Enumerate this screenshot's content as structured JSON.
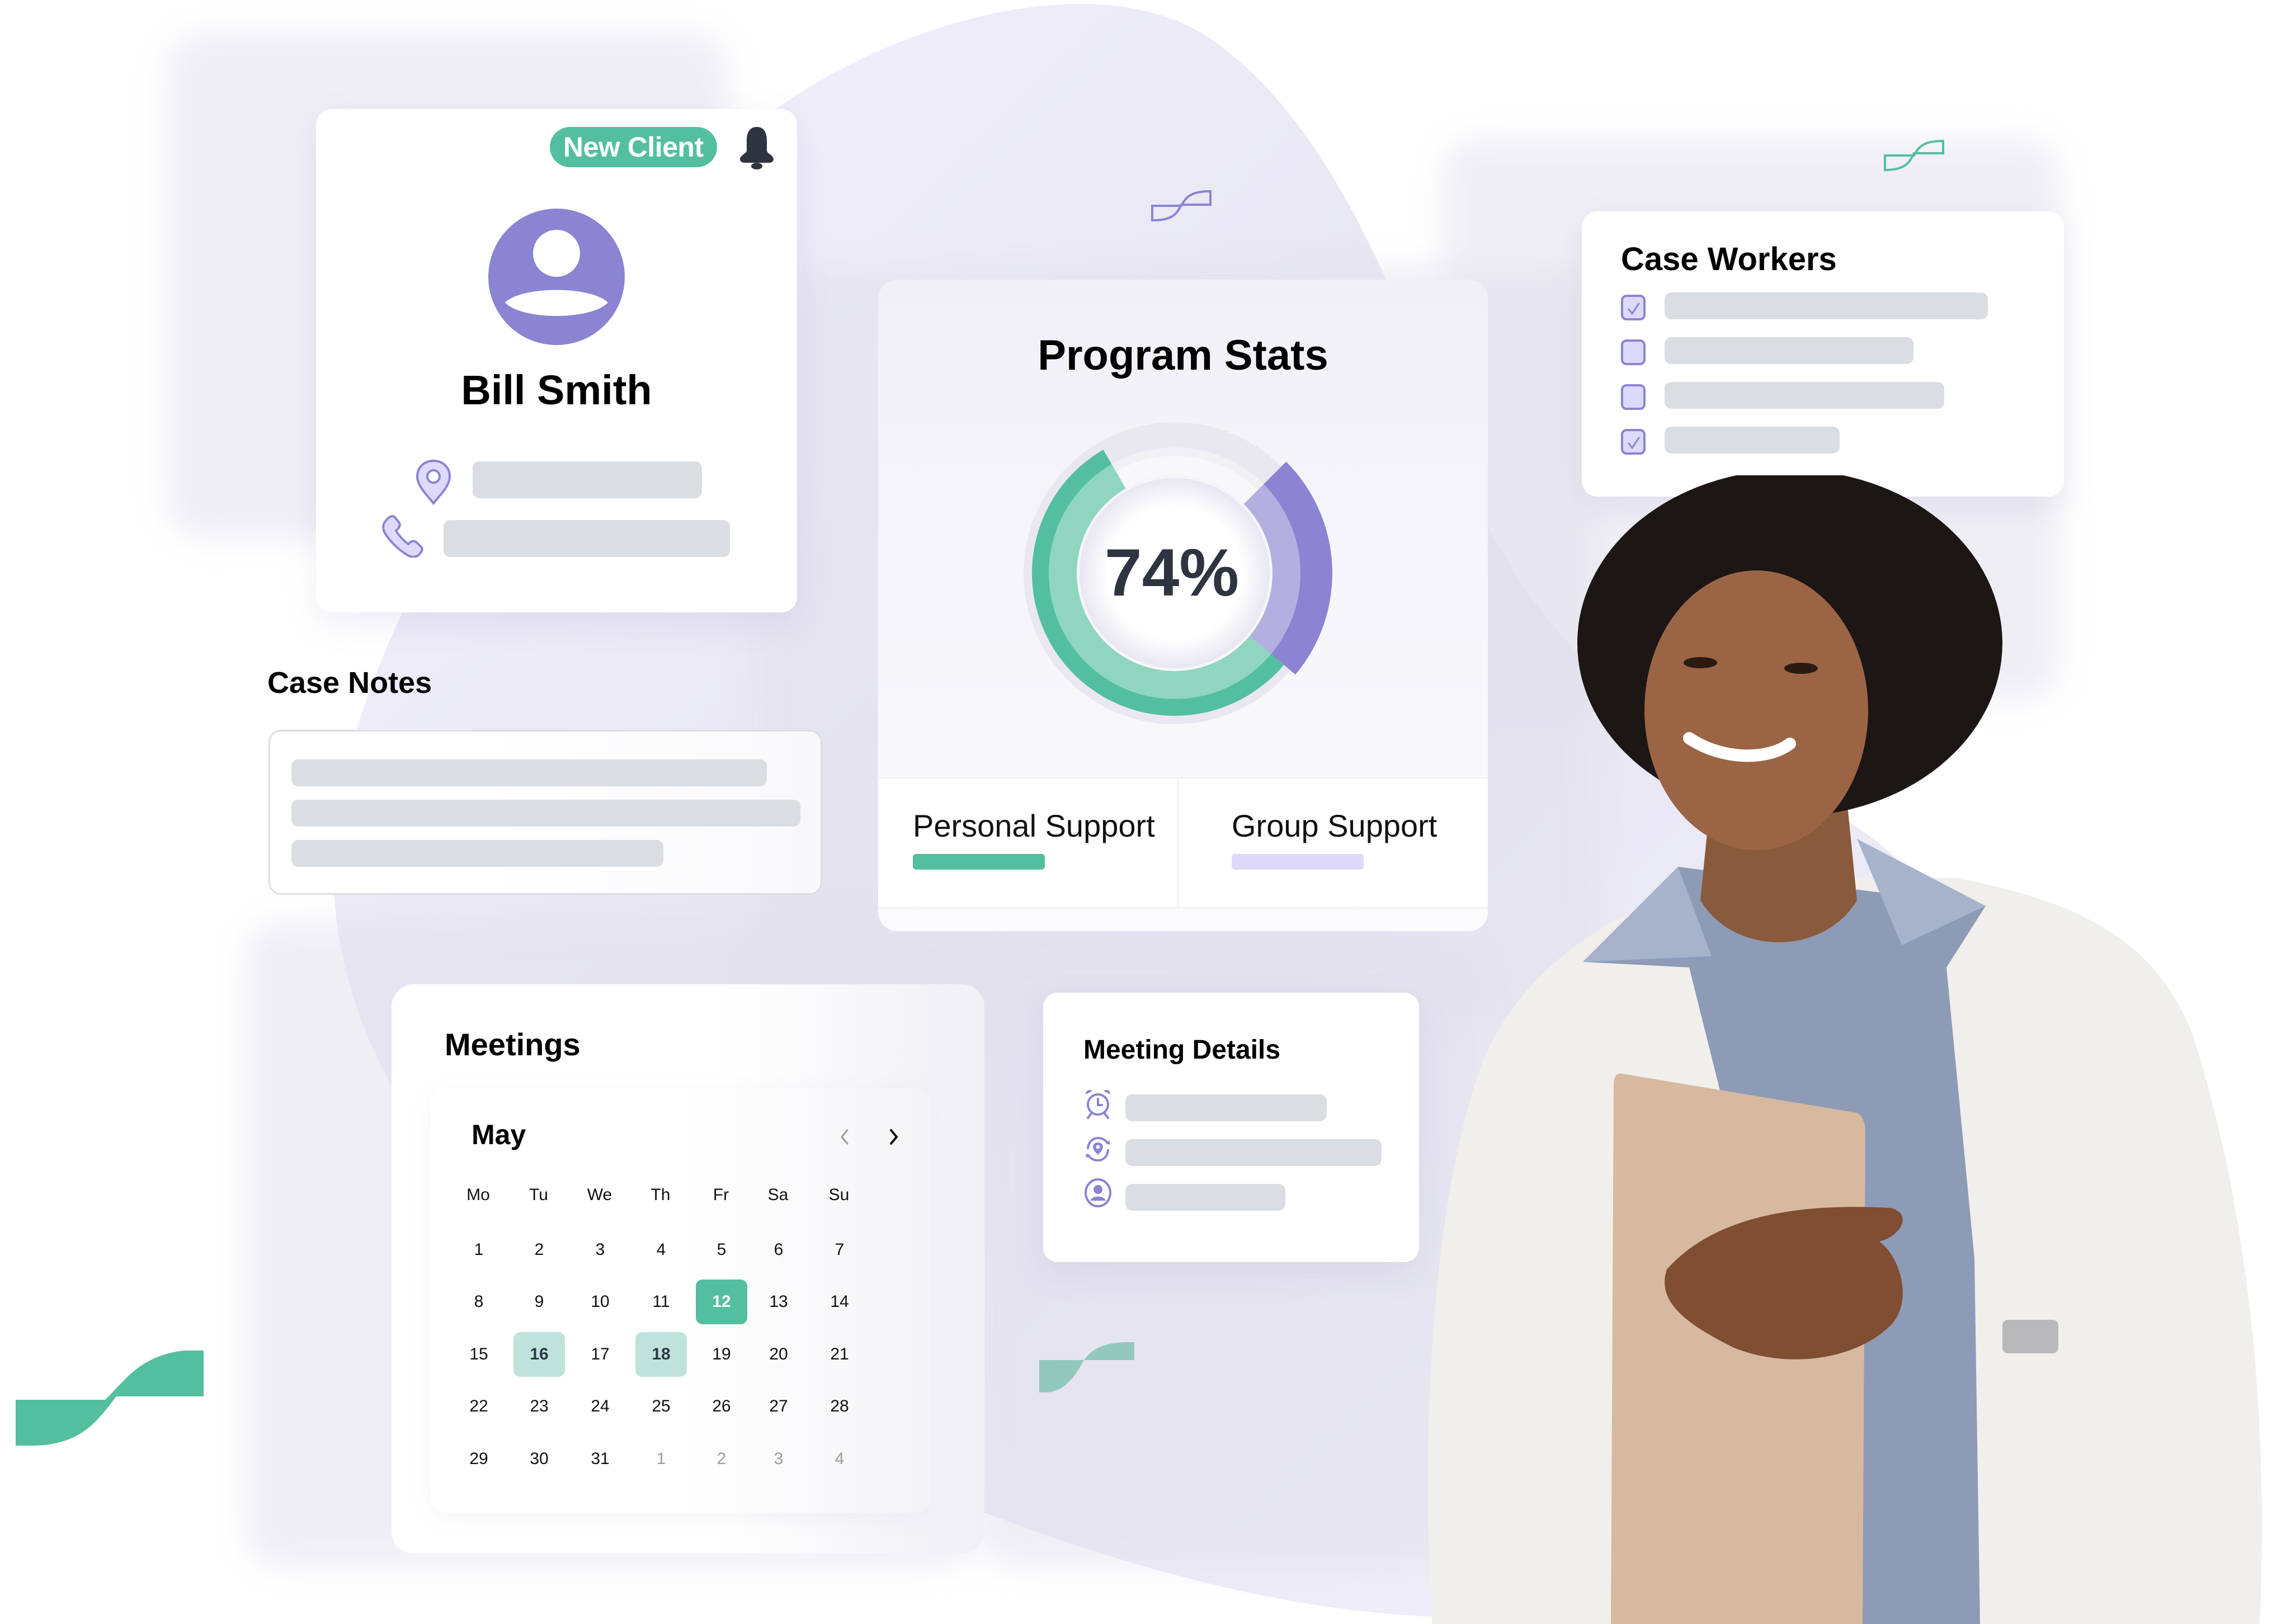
{
  "client_card": {
    "badge": "New Client",
    "name": "Bill Smith",
    "icons": [
      "bell-icon",
      "avatar-icon",
      "location-pin-icon",
      "phone-icon"
    ]
  },
  "program_stats": {
    "title": "Program Stats",
    "center_value": "74%",
    "legend": [
      {
        "label": "Personal Support",
        "color": "#53bf9f"
      },
      {
        "label": "Group Support",
        "color": "#ded9fb"
      }
    ]
  },
  "chart_data": {
    "type": "pie",
    "title": "Program Stats",
    "center_label": "74%",
    "series": [
      {
        "name": "Personal Support",
        "value": 74,
        "color": "#53bf9f"
      },
      {
        "name": "Group Support",
        "value": 26,
        "color": "#8a84d2"
      }
    ],
    "legend_position": "bottom"
  },
  "case_workers": {
    "title": "Case Workers",
    "items": [
      {
        "checked": true
      },
      {
        "checked": false
      },
      {
        "checked": false
      },
      {
        "checked": true
      }
    ]
  },
  "case_notes": {
    "title": "Case Notes"
  },
  "meetings": {
    "title": "Meetings",
    "calendar": {
      "month": "May",
      "prev_icon": "chevron-left-icon",
      "next_icon": "chevron-right-icon",
      "weekdays": [
        "Mo",
        "Tu",
        "We",
        "Th",
        "Fr",
        "Sa",
        "Su"
      ],
      "weeks": [
        [
          {
            "d": "1"
          },
          {
            "d": "2"
          },
          {
            "d": "3"
          },
          {
            "d": "4"
          },
          {
            "d": "5"
          },
          {
            "d": "6"
          },
          {
            "d": "7"
          }
        ],
        [
          {
            "d": "8"
          },
          {
            "d": "9"
          },
          {
            "d": "10"
          },
          {
            "d": "11"
          },
          {
            "d": "12",
            "state": "selected"
          },
          {
            "d": "13"
          },
          {
            "d": "14"
          }
        ],
        [
          {
            "d": "15"
          },
          {
            "d": "16",
            "state": "event"
          },
          {
            "d": "17"
          },
          {
            "d": "18",
            "state": "event"
          },
          {
            "d": "19"
          },
          {
            "d": "20"
          },
          {
            "d": "21"
          }
        ],
        [
          {
            "d": "22"
          },
          {
            "d": "23"
          },
          {
            "d": "24"
          },
          {
            "d": "25"
          },
          {
            "d": "26"
          },
          {
            "d": "27"
          },
          {
            "d": "28"
          }
        ],
        [
          {
            "d": "29"
          },
          {
            "d": "30"
          },
          {
            "d": "31"
          },
          {
            "d": "1",
            "state": "muted"
          },
          {
            "d": "2",
            "state": "muted"
          },
          {
            "d": "3",
            "state": "muted"
          },
          {
            "d": "4",
            "state": "muted"
          }
        ]
      ]
    }
  },
  "meeting_details": {
    "title": "Meeting Details",
    "icons": [
      "alarm-clock-icon",
      "location-sync-icon",
      "user-circle-icon"
    ]
  },
  "colors": {
    "accent_green": "#53bf9f",
    "accent_purple": "#8a84d2",
    "light_purple": "#dcd9fc",
    "skeleton": "#dadde1",
    "blob": "#f3f2fd"
  }
}
